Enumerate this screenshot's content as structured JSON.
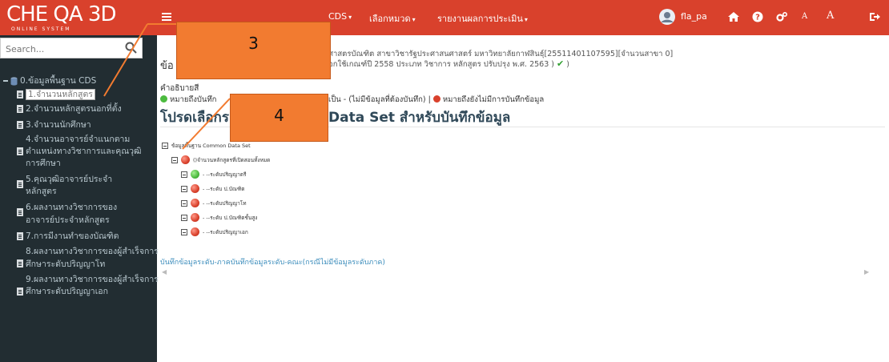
{
  "logo": {
    "main": "CHE QA 3D",
    "sub": "ONLINE SYSTEM"
  },
  "search": {
    "placeholder": "Search..."
  },
  "sidebar": {
    "root_label": "0.ข้อมูลพื้นฐาน CDS",
    "items": [
      {
        "label": "1.จำนวนหลักสูตร"
      },
      {
        "label": "2.จำนวนหลักสูตรนอกที่ตั้ง"
      },
      {
        "label": "3.จำนวนนักศึกษา"
      },
      {
        "label": "4.จำนวนอาจารย์จำแนกตามตำแหน่งทางวิชาการและคุณวุฒิการศึกษา"
      },
      {
        "label": "5.คุณวุฒิอาจารย์ประจำหลักสูตร"
      },
      {
        "label": "6.ผลงานทางวิชาการของอาจารย์ประจำหลักสูตร"
      },
      {
        "label": "7.การมีงานทำของบัณฑิต"
      },
      {
        "label": "8.ผลงานทางวิชาการของผู้สำเร็จการศึกษาระดับปริญญาโท"
      },
      {
        "label": "9.ผลงานทางวิชาการของผู้สำเร็จการศึกษาระดับปริญญาเอก"
      }
    ]
  },
  "navbar": {
    "menu1": "CDS",
    "menu2": "เลือกหมวด",
    "menu3": "รายงานผลการประเมิน",
    "user": "fla_pa",
    "font_small": "A",
    "font_large": "A"
  },
  "content": {
    "line1": "ศาสตรบัณฑิต สาขาวิชารัฐประศาสนศาสตร์ มหาวิทยาลัยกาฬสินธุ์[25511401107595][จำนวนสาขา 0]",
    "line2_prefix": "ข้อ",
    "line2": "อกใช้เกณฑ์ปี 2558 ประเภท วิชาการ หลักสูตร ปรับปรุง พ.ศ. 2563 )",
    "desc_label": "คำอธิบายสี",
    "legend_green": "หมายถึงบันทึก",
    "legend_mid": "เป็น - (ไม่มีข้อมูลที่ต้องบันทึก) |",
    "legend_red": "หมายถึงยังไม่มีการบันทึกข้อมูล",
    "heading_left": "โปรดเลือกร",
    "heading_right": "Data Set สำหรับบันทึกข้อมูล",
    "tree_root": "ข้อมูลพื้นฐาน Common Data Set",
    "tree_child": "()จำนวนหลักสูตรที่เปิดสอนทั้งหมด",
    "tree_leaves": [
      {
        "label": "- --ระดับปริญญาตรี",
        "status": "green"
      },
      {
        "label": "- --ระดับ ป.บัณฑิต",
        "status": "red"
      },
      {
        "label": "- --ระดับปริญญาโท",
        "status": "red"
      },
      {
        "label": "- --ระดับ ป.บัณฑิตชั้นสูง",
        "status": "red"
      },
      {
        "label": "- --ระดับปริญญาเอก",
        "status": "red"
      }
    ],
    "bottom_link": "บันทึกข้อมูลระดับ-ภาคบันทึกข้อมูลระดับ-คณะ(กรณีไม่มีข้อมูลระดับภาค)"
  },
  "annotations": {
    "box3": "3",
    "box4": "4"
  },
  "colors": {
    "brand": "#d9412c",
    "sidebar": "#222d32",
    "callout": "#f27b30",
    "heading": "#2f4858",
    "link": "#3c8dbc"
  }
}
